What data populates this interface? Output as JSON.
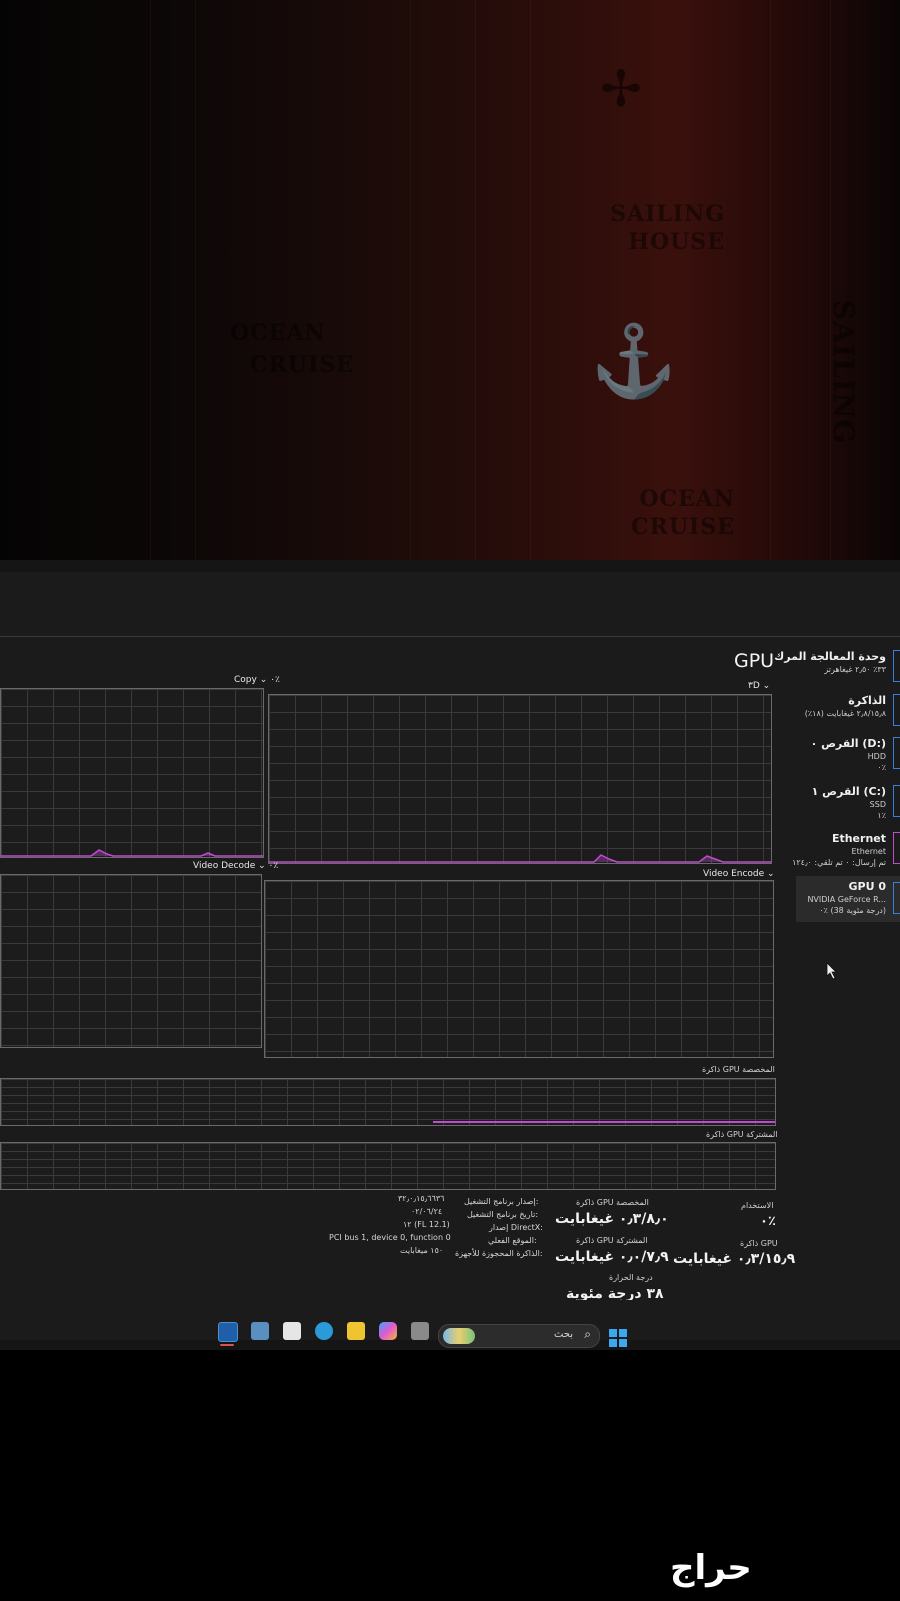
{
  "watermarks": {
    "sailing_house": "SAILING HOUSE",
    "ocean": "OCEAN",
    "cruise": "CRUISE",
    "sailing": "SAILING",
    "ocean_cruise": "OCEAN CRUISE"
  },
  "sidebar": {
    "items": [
      {
        "title": "وحدة المعالجة المرك",
        "line1": "٣٣٪ ٢٫٥٠ غيغاهرتز",
        "line2": ""
      },
      {
        "title": "الذاكرة",
        "line1": "٢٫٨/١٥٫٨ غيغابايت (١٨٪)",
        "line2": ""
      },
      {
        "title": "القرص ٠ (D:)",
        "line1": "HDD",
        "line2": "٠٪"
      },
      {
        "title": "القرص ١ (C:)",
        "line1": "SSD",
        "line2": "١٪"
      },
      {
        "title": "Ethernet",
        "line1": "Ethernet",
        "line2": "تم إرسال: ٠ تم تلقي: ١٢٤٫٠"
      },
      {
        "title": "GPU 0",
        "line1": "NVIDIA GeForce R...",
        "line2": "٠٪ (38 درجة مئوية)"
      }
    ]
  },
  "main": {
    "title": "GPU",
    "graphs": {
      "g3d": "٣D",
      "copy": "Copy",
      "copy_pct": "٠٪",
      "video_encode": "Video Encode",
      "video_decode": "Video Decode",
      "decode_pct": "٠٪",
      "dedicated_mem": "ذاكرة GPU المخصصة",
      "shared_mem": "ذاكرة GPU المشتركة"
    },
    "stats": {
      "usage_label": "الاستخدام",
      "usage_value": "٠٪",
      "gpu_mem_label": "ذاكرة GPU",
      "gpu_mem_value": "٠٫٣/١٥٫٩ غيغابايت",
      "dedicated_label": "ذاكرة GPU المخصصة",
      "dedicated_value": "٠٫٣/٨٫٠ غيغابايت",
      "shared_label": "ذاكرة GPU المشتركة",
      "shared_value": "٠٫٠/٧٫٩ غيغابايت",
      "temp_label": "درجة الحرارة",
      "temp_value": "٣٨ درجة مئوية"
    },
    "info": {
      "driver_version_label": "إصدار برنامج التشغيل:",
      "driver_version_value": "٣٢٫٠٫١٥٫٦٦٣٦",
      "driver_date_label": "تاريخ برنامج التشغيل:",
      "driver_date_value": "٠٢/٠٦/٢٤",
      "directx_label": "إصدار DirectX:",
      "directx_value": "١٢ (FL 12.1)",
      "location_label": "الموقع الفعلي:",
      "location_value": "PCI bus 1, device 0, function 0",
      "reserved_label": "الذاكرة المحجوزة للأجهزة:",
      "reserved_value": "١٥٠ ميغابايت"
    }
  },
  "taskbar": {
    "search_placeholder": "بحث"
  },
  "footer": {
    "logo_text": "حراج"
  },
  "colors": {
    "accent_graph": "#c04ad0",
    "accent_select": "#3b7dd8"
  }
}
